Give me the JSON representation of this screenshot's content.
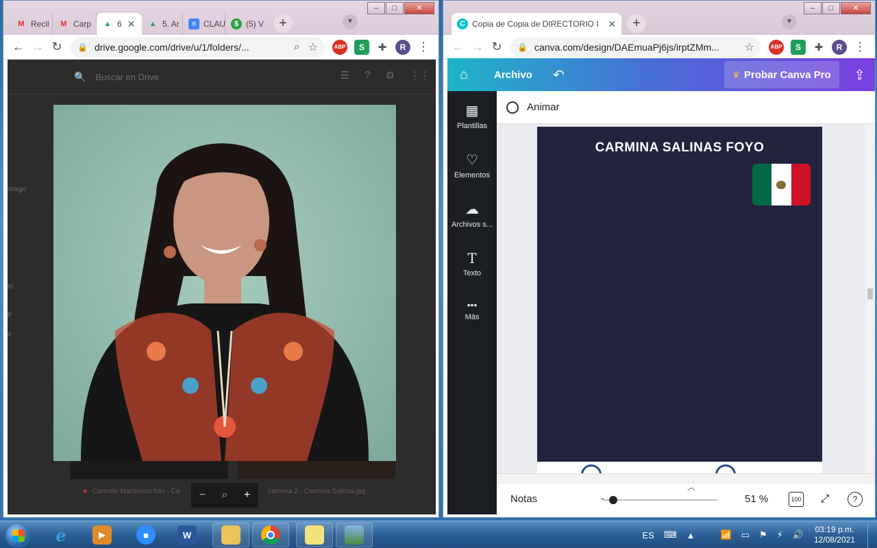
{
  "left_window": {
    "tabs": [
      {
        "label": "Recil",
        "favicon": "gmail-icon",
        "favicon_glyph": "M",
        "color": "#d93025"
      },
      {
        "label": "Carp",
        "favicon": "gmail-icon",
        "favicon_glyph": "M",
        "color": "#d93025"
      },
      {
        "label": "6",
        "favicon": "drive-icon",
        "favicon_glyph": "▲",
        "color": "#1fa463",
        "active": true,
        "close": "✕"
      },
      {
        "label": "5. Ar",
        "favicon": "drive-icon",
        "favicon_glyph": "▲",
        "color": "#1fa463"
      },
      {
        "label": "CLAU",
        "favicon": "docs-icon",
        "favicon_glyph": "≡",
        "color": "#4285f4"
      },
      {
        "label": "(5) V",
        "favicon": "whatsapp-icon",
        "favicon_glyph": "$",
        "color": "#25a244"
      }
    ],
    "url": "drive.google.com/drive/u/1/folders/...",
    "avatar_letter": "R",
    "drive": {
      "search_placeholder": "Buscar en Drive",
      "side_labels": [
        "nmigo",
        "to",
        "p",
        "o"
      ],
      "thumb_captions": [
        "Carmelo Martinucci foto - Ca",
        "carmina 2 - Carmina Salinas.jpg"
      ]
    }
  },
  "right_window": {
    "tab_title": "Copia de Copia de DIRECTORIO I",
    "tab_close": "✕",
    "url": "canva.com/design/DAEmuaPj6js/irptZMm...",
    "avatar_letter": "R",
    "header": {
      "archivo_label": "Archivo",
      "pro_label": "Probar Canva Pro"
    },
    "sidebar": [
      {
        "label": "Plantillas",
        "icon": "templates-icon",
        "glyph": "▦"
      },
      {
        "label": "Elementos",
        "icon": "elements-icon",
        "glyph": "♡"
      },
      {
        "label": "Archivos s...",
        "icon": "upload-icon",
        "glyph": "☁"
      },
      {
        "label": "Texto",
        "icon": "text-icon",
        "glyph": "T"
      },
      {
        "label": "Más",
        "icon": "more-icon",
        "glyph": "•••"
      }
    ],
    "animate_label": "Animar",
    "page_title": "CARMINA SALINAS FOYO",
    "footer": {
      "notes_label": "Notas",
      "zoom_value": "51 %",
      "page_badge": "100"
    }
  },
  "taskbar": {
    "language": "ES",
    "time": "03:19 p.m.",
    "date": "12/08/2021"
  },
  "colors": {
    "canva_page": "#22233d",
    "canva_sidebar": "#1b1f24",
    "flag_green": "#006847",
    "flag_red": "#ce1126"
  }
}
